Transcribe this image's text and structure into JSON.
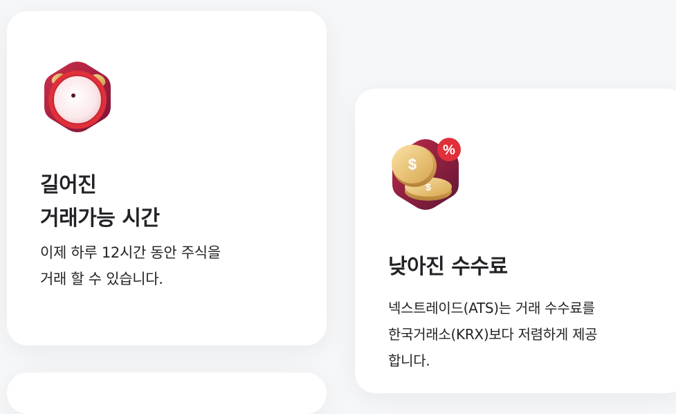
{
  "features": [
    {
      "icon": "alarm-clock-icon",
      "title_lines": [
        "길어진",
        "거래가능 시간"
      ],
      "desc_lines": [
        "이제 하루 12시간 동안 주식을",
        "거래 할 수 있습니다."
      ]
    },
    {
      "icon": "coins-percent-icon",
      "title_lines": [
        "낮아진 수수료"
      ],
      "desc_lines": [
        "넥스트레이드(ATS)는 거래 수수료를",
        "한국거래소(KRX)보다 저렴하게 제공",
        "합니다."
      ]
    }
  ],
  "colors": {
    "background": "#f6f7f9",
    "card": "#ffffff",
    "text": "#222326",
    "accent_red": "#e0303a",
    "accent_crimson": "#a01a3a",
    "coin_gold": "#e8c27a"
  }
}
